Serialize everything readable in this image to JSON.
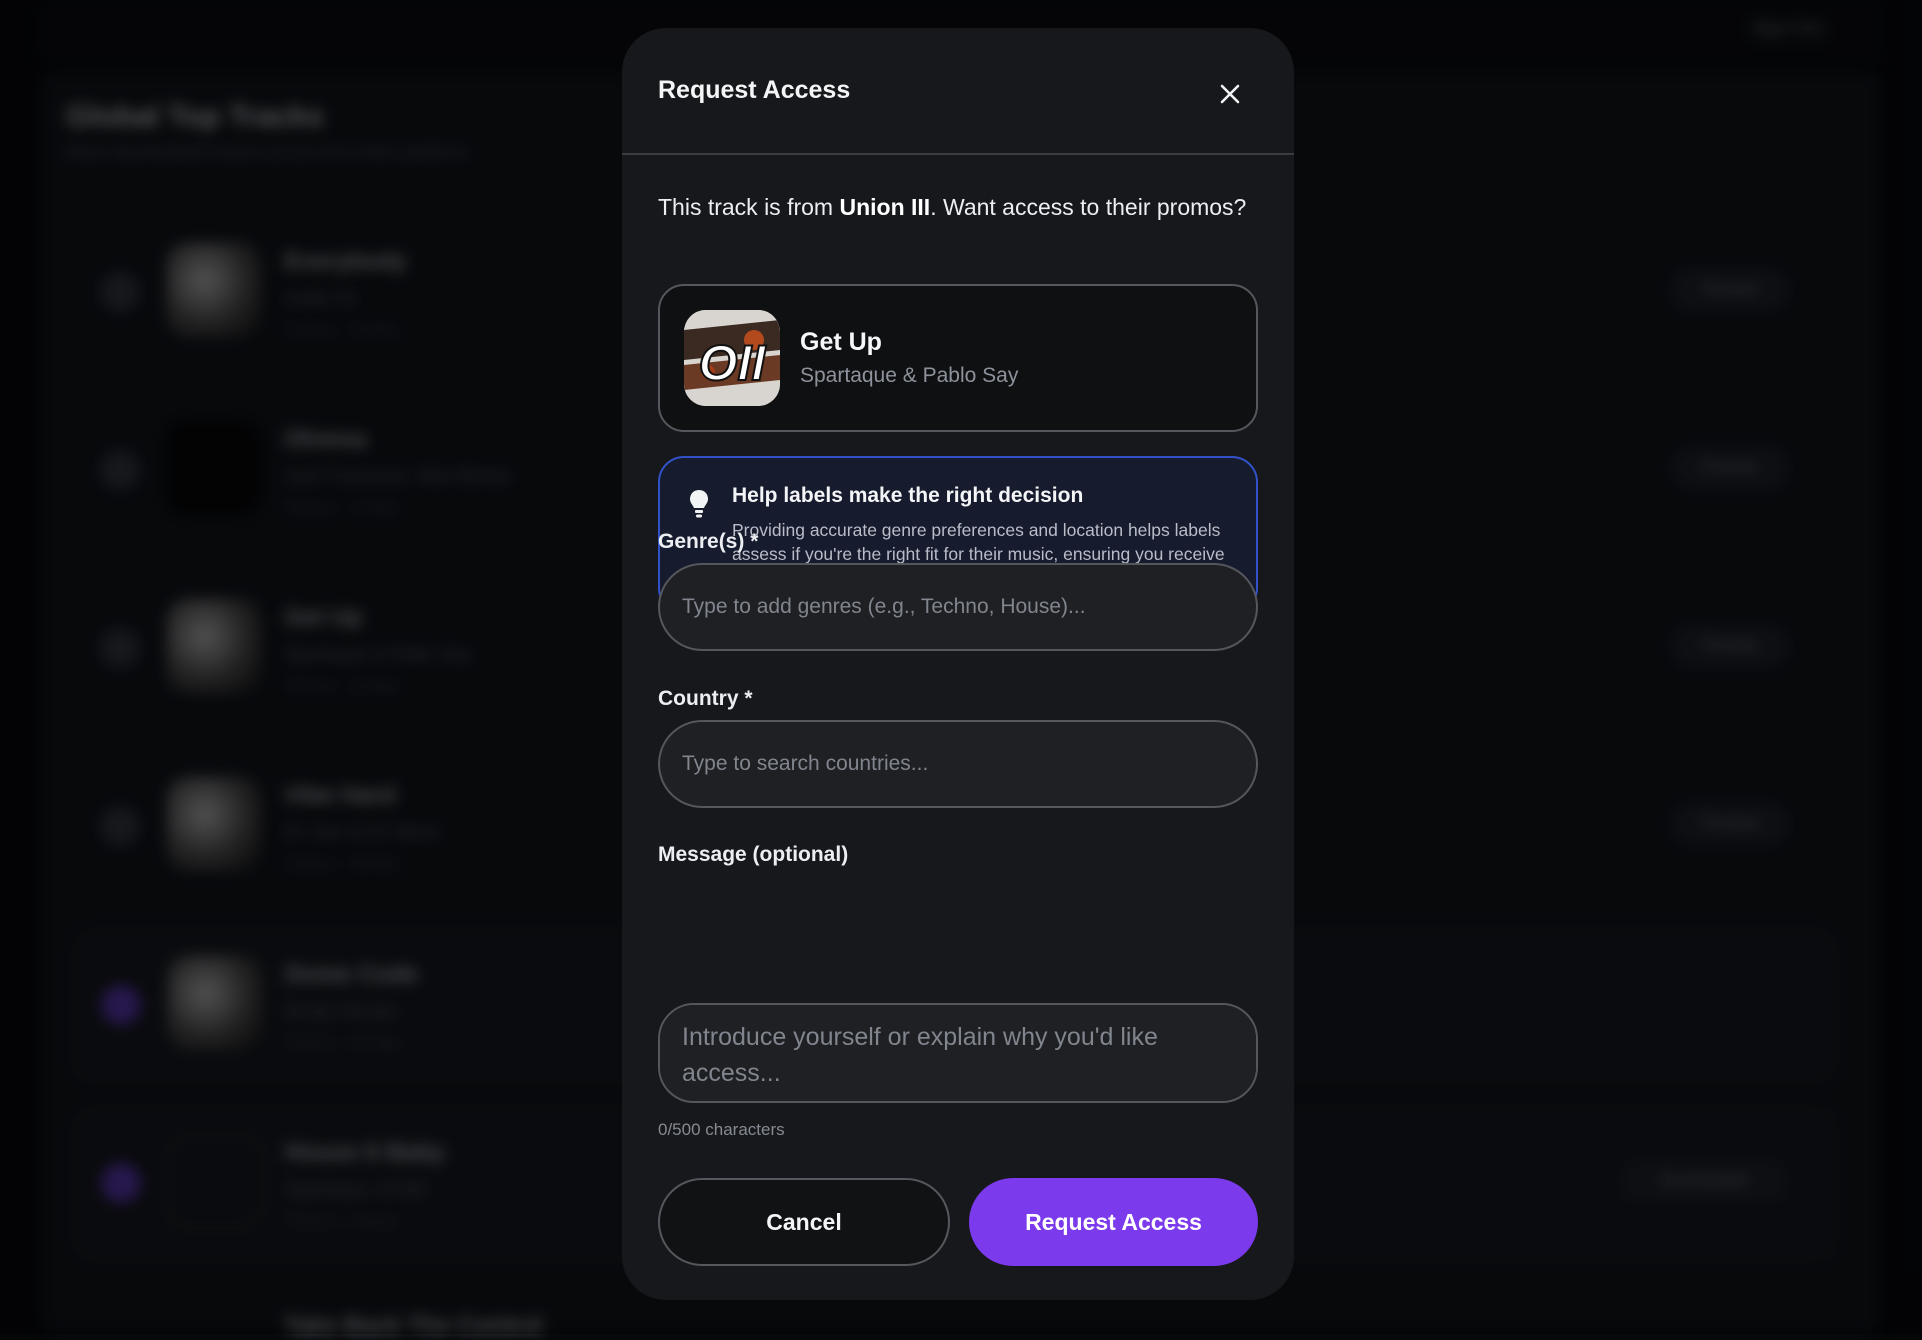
{
  "background": {
    "topbar_right": "Sign Out",
    "title": "Global Top Tracks",
    "subtitle": "Most downloaded tracks across the entire platform",
    "rows": [
      {
        "title": "Everybody",
        "artist": "Audio Kit",
        "meta": "Techno · 24 Mar",
        "button": "Preview"
      },
      {
        "title": "Ohmna",
        "artist": "Jack Truamane, Niko Bertan",
        "meta": "Techno · 12 Mar",
        "button": "Preview"
      },
      {
        "title": "Get Up",
        "artist": "Spartaque & Pablo Say",
        "meta": "Techno · 10 Mar",
        "button": "Preview"
      },
      {
        "title": "Vibe Hard",
        "artist": "DJ Jam & DJ Steve",
        "meta": "Techno · 08 Mar",
        "button": "Preview"
      },
      {
        "title": "Dome Code",
        "artist": "Brody, Revalu",
        "meta": "Techno · 01 Mar",
        "button": ""
      },
      {
        "title": "House It Baby",
        "artist": "Spartaque, Hi Wit",
        "meta": "Techno · House",
        "button": "Downloaded"
      }
    ],
    "bottom_row_title": "Take Back The Control"
  },
  "modal": {
    "title": "Request Access",
    "intro_prefix": "This track is from ",
    "label_name": "Union III",
    "intro_suffix": ". Want access to their promos?",
    "track": {
      "title": "Get Up",
      "artist": "Spartaque & Pablo Say",
      "art_text": "OII"
    },
    "tip": {
      "title": "Help labels make the right decision",
      "body": "Providing accurate genre preferences and location helps labels assess if you're the right fit for their music, ensuring you receive promos that match your taste."
    },
    "genres": {
      "label": "Genre(s) *",
      "placeholder": "Type to add genres (e.g., Techno, House)...",
      "value": ""
    },
    "country": {
      "label": "Country *",
      "placeholder": "Type to search countries...",
      "value": ""
    },
    "message": {
      "label": "Message (optional)",
      "placeholder": "Introduce yourself or explain why you'd like access...",
      "value": "",
      "char_count": "0/500 characters"
    },
    "cancel_label": "Cancel",
    "submit_label": "Request Access"
  },
  "colors": {
    "accent": "#7c3aed",
    "tip_border": "#3352c9",
    "modal_bg": "#17181b"
  },
  "icons": {
    "close": "close-icon",
    "tip": "lightbulb-icon"
  }
}
